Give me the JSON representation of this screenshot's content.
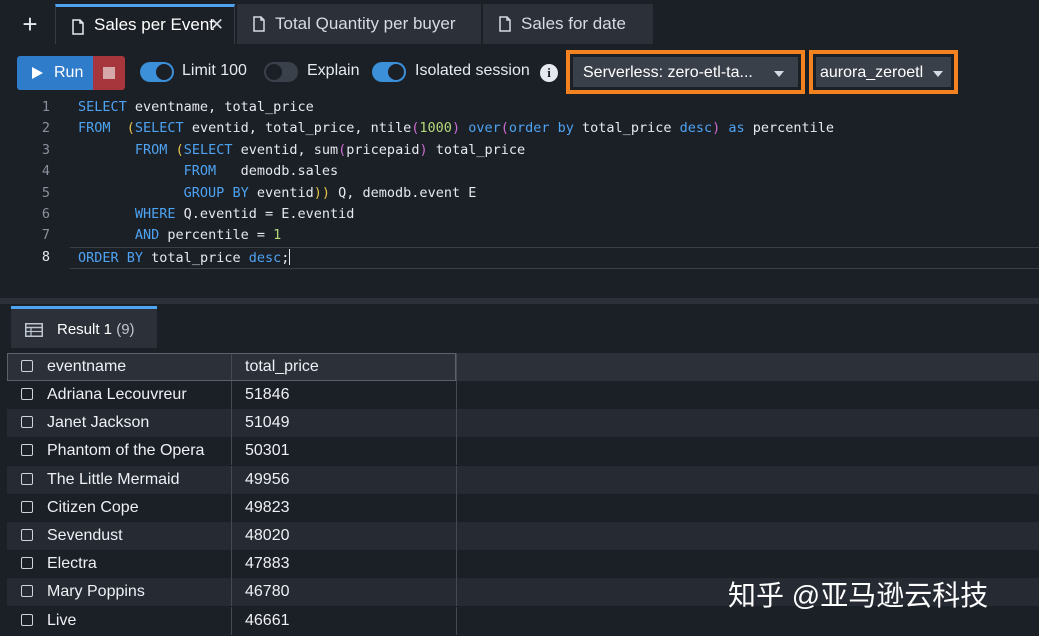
{
  "tabs": [
    {
      "label": "Sales per Event",
      "active": true
    },
    {
      "label": "Total Quantity per buyer",
      "active": false
    },
    {
      "label": "Sales for date",
      "active": false
    }
  ],
  "toolbar": {
    "run_label": "Run",
    "limit_label": "Limit 100",
    "limit_on": true,
    "explain_label": "Explain",
    "explain_on": false,
    "isolated_label": "Isolated session",
    "isolated_on": true,
    "info_glyph": "i",
    "connection_value": "Serverless: zero-etl-ta...",
    "database_value": "aurora_zeroetl"
  },
  "editor": {
    "line_numbers": [
      "1",
      "2",
      "3",
      "4",
      "5",
      "6",
      "7",
      "8"
    ],
    "lines": [
      "SELECT eventname, total_price",
      "FROM  (SELECT eventid, total_price, ntile(1000) over(order by total_price desc) as percentile",
      "       FROM (SELECT eventid, sum(pricepaid) total_price",
      "             FROM   demodb.sales",
      "             GROUP BY eventid)) Q, demodb.event E",
      "       WHERE Q.eventid = E.eventid",
      "       AND percentile = 1",
      "ORDER BY total_price desc;"
    ]
  },
  "results": {
    "tab_label": "Result 1",
    "count": "(9)",
    "columns": [
      "eventname",
      "total_price"
    ],
    "rows": [
      [
        "Adriana Lecouvreur",
        "51846"
      ],
      [
        "Janet Jackson",
        "51049"
      ],
      [
        "Phantom of the Opera",
        "50301"
      ],
      [
        "The Little Mermaid",
        "49956"
      ],
      [
        "Citizen Cope",
        "49823"
      ],
      [
        "Sevendust",
        "48020"
      ],
      [
        "Electra",
        "47883"
      ],
      [
        "Mary Poppins",
        "46780"
      ],
      [
        "Live",
        "46661"
      ]
    ]
  },
  "watermark": "知乎 @亚马逊云科技",
  "colors": {
    "accent": "#4ea3f2",
    "run": "#2f7ccb",
    "stop": "#a6363b",
    "highlight": "#f58220",
    "background": "#1b1f26"
  }
}
